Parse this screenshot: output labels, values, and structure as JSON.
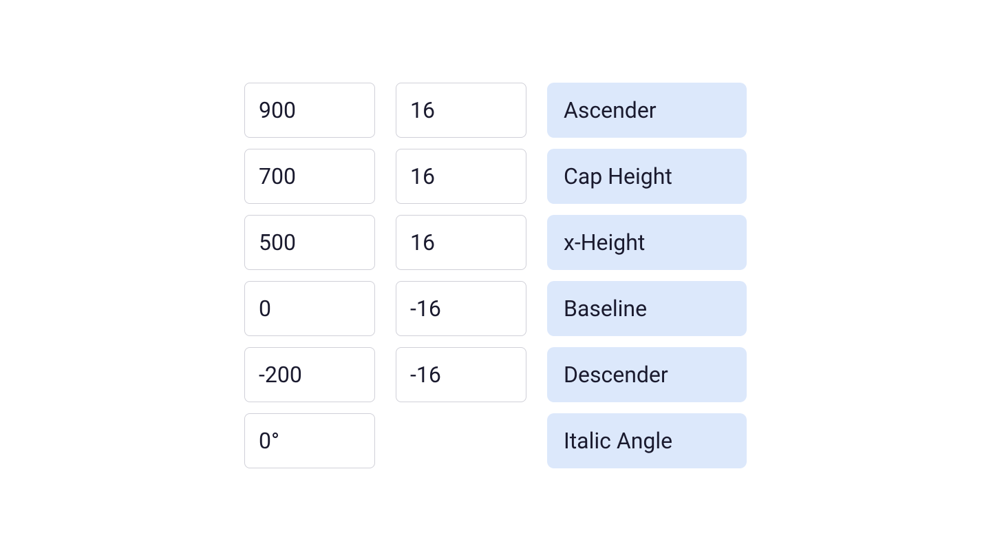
{
  "rows": [
    {
      "col1": "900",
      "col2": "16",
      "label": "Ascender"
    },
    {
      "col1": "700",
      "col2": "16",
      "label": "Cap Height"
    },
    {
      "col1": "500",
      "col2": "16",
      "label": "x-Height"
    },
    {
      "col1": "0",
      "col2": "-16",
      "label": "Baseline"
    },
    {
      "col1": "-200",
      "col2": "-16",
      "label": "Descender"
    },
    {
      "col1": "0°",
      "col2": null,
      "label": "Italic Angle"
    }
  ]
}
